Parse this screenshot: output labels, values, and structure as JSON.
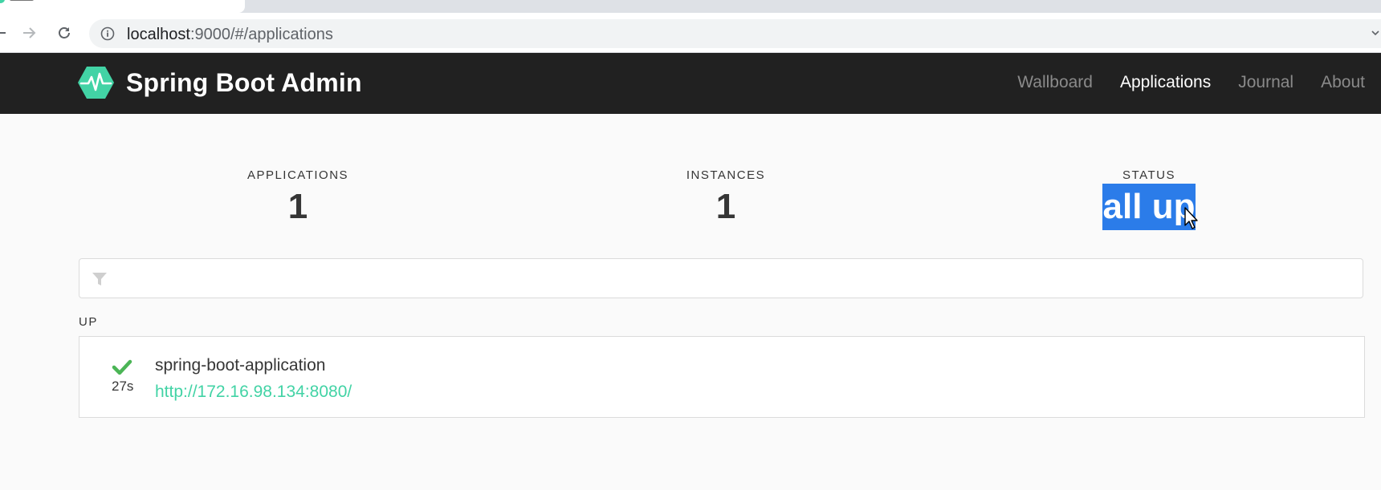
{
  "browser": {
    "url_host": "localhost",
    "url_rest": ":9000/#/applications"
  },
  "navbar": {
    "title": "Spring Boot Admin",
    "links": [
      {
        "label": "Wallboard",
        "active": false
      },
      {
        "label": "Applications",
        "active": true
      },
      {
        "label": "Journal",
        "active": false
      },
      {
        "label": "About",
        "active": false
      }
    ]
  },
  "stats": {
    "applications": {
      "label": "APPLICATIONS",
      "value": "1"
    },
    "instances": {
      "label": "INSTANCES",
      "value": "1"
    },
    "status": {
      "label": "STATUS",
      "value": "all up"
    }
  },
  "filter": {
    "placeholder": "",
    "icon": "filter-icon"
  },
  "groups": [
    {
      "label": "UP",
      "applications": [
        {
          "name": "spring-boot-application",
          "url": "http://172.16.98.134:8080/",
          "age": "27s",
          "status_icon": "check-icon"
        }
      ]
    }
  ],
  "colors": {
    "brand": "#42d3a5",
    "navbar": "#212121",
    "up": "#4bb556",
    "selection": "#2b7ce9"
  }
}
